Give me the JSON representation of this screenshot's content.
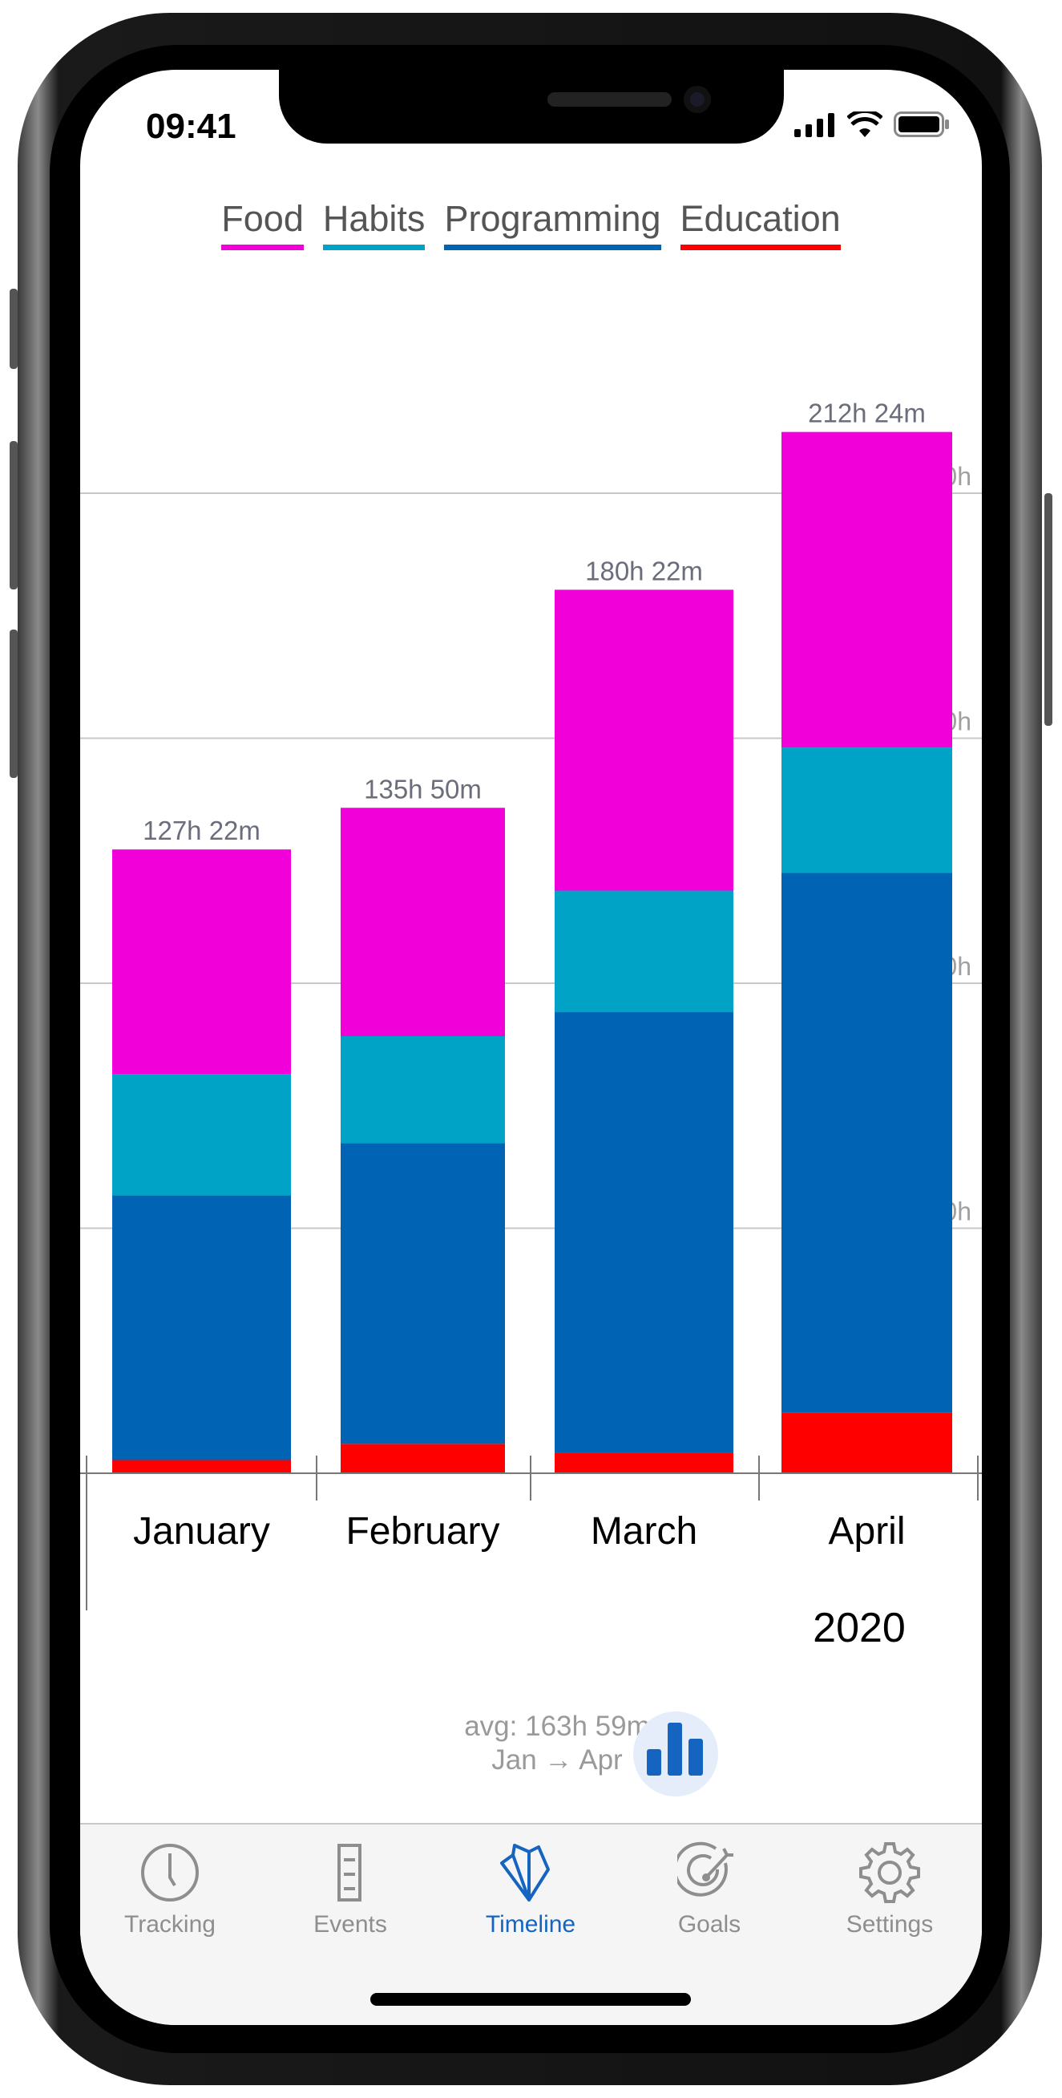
{
  "status_bar": {
    "time": "09:41"
  },
  "legend": [
    {
      "label": "Food",
      "color": "#f200da"
    },
    {
      "label": "Habits",
      "color": "#00a3c6"
    },
    {
      "label": "Programming",
      "color": "#0063b4"
    },
    {
      "label": "Education",
      "color": "#ff0000"
    }
  ],
  "chart_data": {
    "type": "bar",
    "stacked": true,
    "categories": [
      "January",
      "February",
      "March",
      "April"
    ],
    "year_label": "2020",
    "series": [
      {
        "name": "Education",
        "color": "#ff0000",
        "values": [
          2.7,
          6.0,
          4.1,
          12.3
        ]
      },
      {
        "name": "Programming",
        "color": "#0063b4",
        "values": [
          54.0,
          61.4,
          90.0,
          110.2
        ]
      },
      {
        "name": "Habits",
        "color": "#00a3c6",
        "values": [
          24.8,
          21.8,
          24.8,
          25.6
        ]
      },
      {
        "name": "Food",
        "color": "#f200da",
        "values": [
          45.8,
          46.6,
          61.4,
          64.4
        ]
      }
    ],
    "totals": [
      "127h 22m",
      "135h 50m",
      "180h 22m",
      "212h 24m"
    ],
    "y_unit": "h",
    "y_gridlines": [
      50,
      100,
      150,
      200
    ],
    "ylim": [
      0,
      220
    ],
    "grid": true
  },
  "summary": {
    "avg": "avg: 163h 59m",
    "range": "Jan → Apr"
  },
  "chart_type_button": {
    "icon": "bar-chart-icon",
    "color": "#1565c0"
  },
  "tabs": [
    {
      "label": "Tracking",
      "icon": "clock-icon",
      "active": false
    },
    {
      "label": "Events",
      "icon": "list-icon",
      "active": false
    },
    {
      "label": "Timeline",
      "icon": "timeline-icon",
      "active": true
    },
    {
      "label": "Goals",
      "icon": "target-icon",
      "active": false
    },
    {
      "label": "Settings",
      "icon": "gear-icon",
      "active": false
    }
  ]
}
